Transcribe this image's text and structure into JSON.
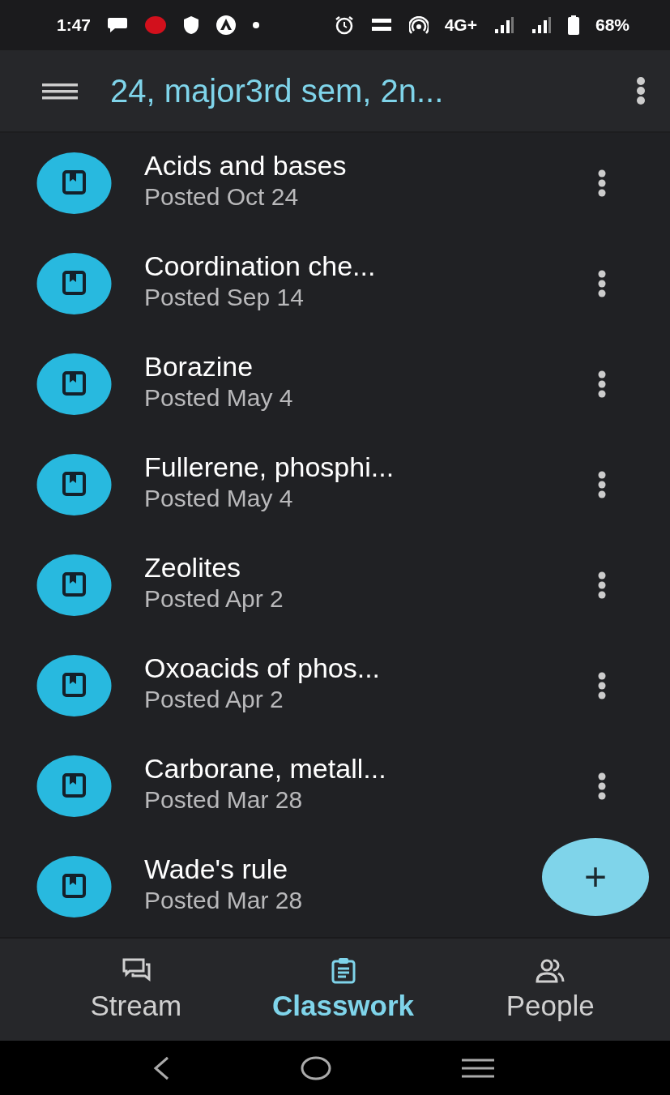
{
  "status_bar": {
    "time": "1:47",
    "network": "4G+",
    "battery": "68%"
  },
  "app_bar": {
    "title": "24, major3rd sem,  2n..."
  },
  "assignments": [
    {
      "title": "Acids and bases",
      "posted": "Posted Oct 24",
      "menu": true
    },
    {
      "title": "Coordination che...",
      "posted": "Posted Sep 14",
      "menu": true
    },
    {
      "title": "Borazine",
      "posted": "Posted May 4",
      "menu": true
    },
    {
      "title": "Fullerene, phosphi...",
      "posted": "Posted May 4",
      "menu": true
    },
    {
      "title": "Zeolites",
      "posted": "Posted Apr 2",
      "menu": true
    },
    {
      "title": "Oxoacids of phos...",
      "posted": "Posted Apr 2",
      "menu": true
    },
    {
      "title": "Carborane, metall...",
      "posted": "Posted Mar 28",
      "menu": true
    },
    {
      "title": "Wade's rule",
      "posted": "Posted Mar 28",
      "menu": false
    }
  ],
  "fab": {
    "label": "+"
  },
  "bottom_nav": [
    {
      "label": "Stream",
      "selected": false
    },
    {
      "label": "Classwork",
      "selected": true
    },
    {
      "label": "People",
      "selected": false
    }
  ]
}
